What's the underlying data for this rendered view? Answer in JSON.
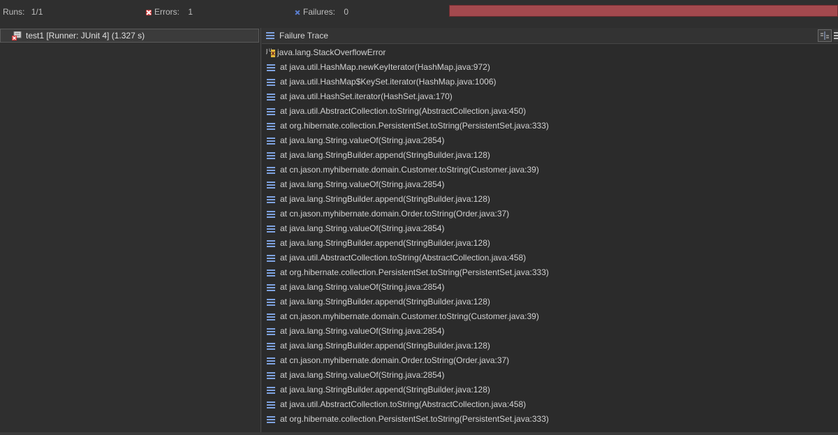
{
  "stats": {
    "runs_label": "Runs:",
    "runs_value": "1/1",
    "errors_label": "Errors:",
    "errors_value": "1",
    "failures_label": "Failures:",
    "failures_value": "0"
  },
  "progress": {
    "status": "error",
    "color": "#a3494e",
    "fraction": 1.0
  },
  "tree": {
    "items": [
      {
        "label": "test1 [Runner: JUnit 4] (1.327 s)",
        "status": "error"
      }
    ]
  },
  "trace": {
    "title": "Failure Trace",
    "exception": "java.lang.StackOverflowError",
    "lines": [
      "at java.util.HashMap.newKeyIterator(HashMap.java:972)",
      "at java.util.HashMap$KeySet.iterator(HashMap.java:1006)",
      "at java.util.HashSet.iterator(HashSet.java:170)",
      "at java.util.AbstractCollection.toString(AbstractCollection.java:450)",
      "at org.hibernate.collection.PersistentSet.toString(PersistentSet.java:333)",
      "at java.lang.String.valueOf(String.java:2854)",
      "at java.lang.StringBuilder.append(StringBuilder.java:128)",
      "at cn.jason.myhibernate.domain.Customer.toString(Customer.java:39)",
      "at java.lang.String.valueOf(String.java:2854)",
      "at java.lang.StringBuilder.append(StringBuilder.java:128)",
      "at cn.jason.myhibernate.domain.Order.toString(Order.java:37)",
      "at java.lang.String.valueOf(String.java:2854)",
      "at java.lang.StringBuilder.append(StringBuilder.java:128)",
      "at java.util.AbstractCollection.toString(AbstractCollection.java:458)",
      "at org.hibernate.collection.PersistentSet.toString(PersistentSet.java:333)",
      "at java.lang.String.valueOf(String.java:2854)",
      "at java.lang.StringBuilder.append(StringBuilder.java:128)",
      "at cn.jason.myhibernate.domain.Customer.toString(Customer.java:39)",
      "at java.lang.String.valueOf(String.java:2854)",
      "at java.lang.StringBuilder.append(StringBuilder.java:128)",
      "at cn.jason.myhibernate.domain.Order.toString(Order.java:37)",
      "at java.lang.String.valueOf(String.java:2854)",
      "at java.lang.StringBuilder.append(StringBuilder.java:128)",
      "at java.util.AbstractCollection.toString(AbstractCollection.java:458)",
      "at org.hibernate.collection.PersistentSet.toString(PersistentSet.java:333)"
    ]
  },
  "icons": {
    "error": "error-x-icon",
    "failure": "failure-x-icon",
    "stack-frame": "stack-frame-icon",
    "compare": "compare-icon"
  }
}
